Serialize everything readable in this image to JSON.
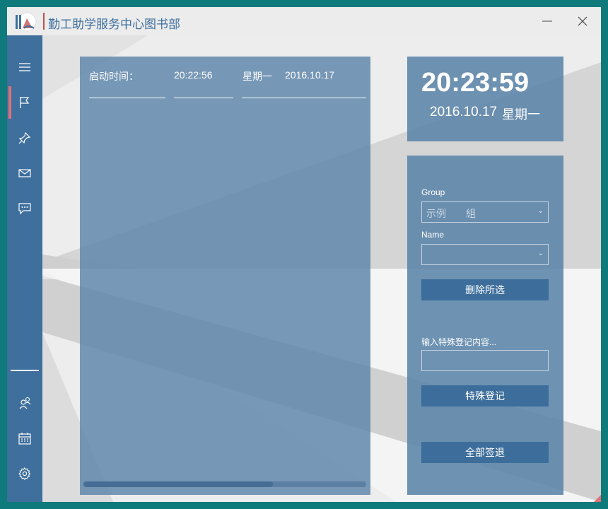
{
  "window": {
    "title": "勤工助学服务中心图书部"
  },
  "sidebar": {
    "items": [
      {
        "icon": "hamburger-menu-icon"
      },
      {
        "icon": "flag-icon"
      },
      {
        "icon": "pin-icon"
      },
      {
        "icon": "mail-icon"
      },
      {
        "icon": "chat-icon"
      },
      {
        "icon": "users-icon"
      },
      {
        "icon": "calendar-icon"
      },
      {
        "icon": "gear-icon"
      }
    ],
    "active_index": 1
  },
  "log": {
    "start_label": "启动时间：",
    "start_time": "20:22:56",
    "weekday": "星期一",
    "date": "2016.10.17"
  },
  "clock": {
    "time": "20:23:59",
    "date": "2016.10.17",
    "weekday": "星期一"
  },
  "form": {
    "group_label": "Group",
    "group_value": "示例　　組",
    "name_label": "Name",
    "name_value": "",
    "delete_button": "删除所选",
    "special_label": "输入特殊登记内容...",
    "special_value": "",
    "special_button": "特殊登记",
    "signout_button": "全部签退"
  },
  "colors": {
    "accent": "#3f6f9c",
    "panel": "#5b84a8",
    "highlight": "#e0707a",
    "frame": "#0f7a7c"
  }
}
